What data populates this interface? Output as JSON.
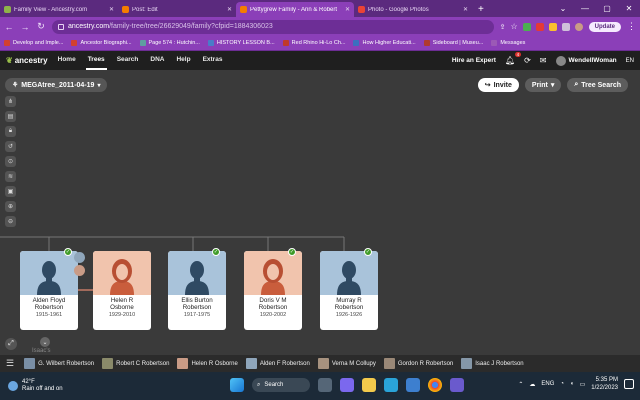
{
  "browser": {
    "tabs": [
      {
        "label": "Family View - Ancestry.com",
        "color": "#8fb34a",
        "active": false
      },
      {
        "label": "Post: Edit",
        "color": "#f57d00",
        "active": false
      },
      {
        "label": "Pettygrew Family - Ann & Robert",
        "color": "#f57d00",
        "active": true
      },
      {
        "label": "Photo - Google Photos",
        "color": "#ea4335",
        "active": false
      }
    ],
    "url_host": "ancestry.com",
    "url_path": "/family-tree/tree/26629049/family?cfpid=1884306023",
    "update_label": "Update",
    "bookmarks": [
      {
        "label": "Develop and Imple...",
        "color": "#d2402f"
      },
      {
        "label": "Ancestor Biographi...",
        "color": "#d2402f"
      },
      {
        "label": "Page 574 : Hutchin...",
        "color": "#5f9ea0"
      },
      {
        "label": "HISTORY LESSON B...",
        "color": "#4a7cc8"
      },
      {
        "label": "Red Rhino Hi-Lo Ch...",
        "color": "#c0392b"
      },
      {
        "label": "How Higher Educati...",
        "color": "#3c6fbf"
      },
      {
        "label": "Sideboard | Museu...",
        "color": "#b03a2e"
      },
      {
        "label": "Messages",
        "color": "#9b59b6"
      }
    ]
  },
  "header": {
    "logo": "ancestry",
    "nav": [
      "Home",
      "Trees",
      "Search",
      "DNA",
      "Help",
      "Extras"
    ],
    "active_nav": "Trees",
    "hire_label": "Hire an Expert",
    "notification_count": "4",
    "username": "WendellWoman",
    "lang": "EN"
  },
  "toolbar": {
    "tree_name": "MEGAtree_2011-04-19",
    "invite_label": "Invite",
    "print_label": "Print",
    "tree_search_label": "Tree Search"
  },
  "people": [
    {
      "name_line1": "Alden Floyd",
      "name_line2": "Robertson",
      "dates": "1915-1961",
      "sex": "male",
      "hint": true
    },
    {
      "name_line1": "Helen R",
      "name_line2": "Osborne",
      "dates": "1929-2010",
      "sex": "female",
      "hint": false
    },
    {
      "name_line1": "Ellis Burton",
      "name_line2": "Robertson",
      "dates": "1917-1975",
      "sex": "male",
      "hint": true
    },
    {
      "name_line1": "Doris V M",
      "name_line2": "Robertson",
      "dates": "1920-2002",
      "sex": "female",
      "hint": true
    },
    {
      "name_line1": "Murray R",
      "name_line2": "Robertson",
      "dates": "1926-1926",
      "sex": "male",
      "hint": true
    }
  ],
  "cut_name": "Isaac's",
  "strip": [
    {
      "name": "G. Wilbert Robertson",
      "color": "#7a8fa6"
    },
    {
      "name": "Robert C Robertson",
      "color": "#8a8a6a"
    },
    {
      "name": "Helen R Osborne",
      "color": "#c99b86"
    },
    {
      "name": "Alden F Robertson",
      "color": "#8fa6bb"
    },
    {
      "name": "Verna M Collupy",
      "color": "#a7927f"
    },
    {
      "name": "Gordon R Robertson",
      "color": "#9a8877"
    },
    {
      "name": "Isaac J Robertson",
      "color": "#8597a8"
    }
  ],
  "taskbar": {
    "temp": "42°F",
    "weather": "Rain off and on",
    "search_label": "Search",
    "lang": "ENG",
    "time": "5:35 PM",
    "date": "1/22/2023"
  }
}
